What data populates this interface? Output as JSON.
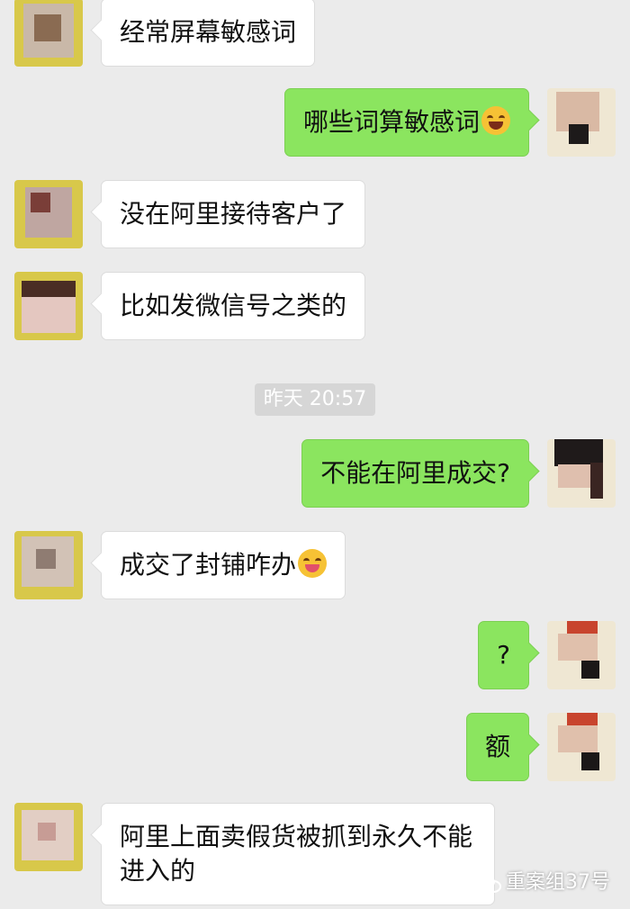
{
  "conversation": {
    "messages": [
      {
        "side": "left",
        "text": "经常屏幕敏感词"
      },
      {
        "side": "right",
        "text": "哪些词算敏感词",
        "emoji": "laughing-tears-emoji"
      },
      {
        "side": "left",
        "text": "没在阿里接待客户了"
      },
      {
        "side": "left",
        "text": "比如发微信号之类的"
      },
      {
        "side": "right",
        "text": "不能在阿里成交?"
      },
      {
        "side": "left",
        "text": "成交了封铺咋办",
        "emoji": "wink-tongue-emoji"
      },
      {
        "side": "right",
        "text": "?"
      },
      {
        "side": "right",
        "text": "额"
      },
      {
        "side": "left",
        "text": "阿里上面卖假货被抓到永久不能进入的"
      }
    ],
    "timestamp": "昨天 20:57"
  },
  "watermark": {
    "icon": "wechat-icon",
    "text": "重案组37号"
  },
  "colors": {
    "background": "#ebebeb",
    "sent_bubble": "#8be55f",
    "received_bubble": "#ffffff"
  }
}
